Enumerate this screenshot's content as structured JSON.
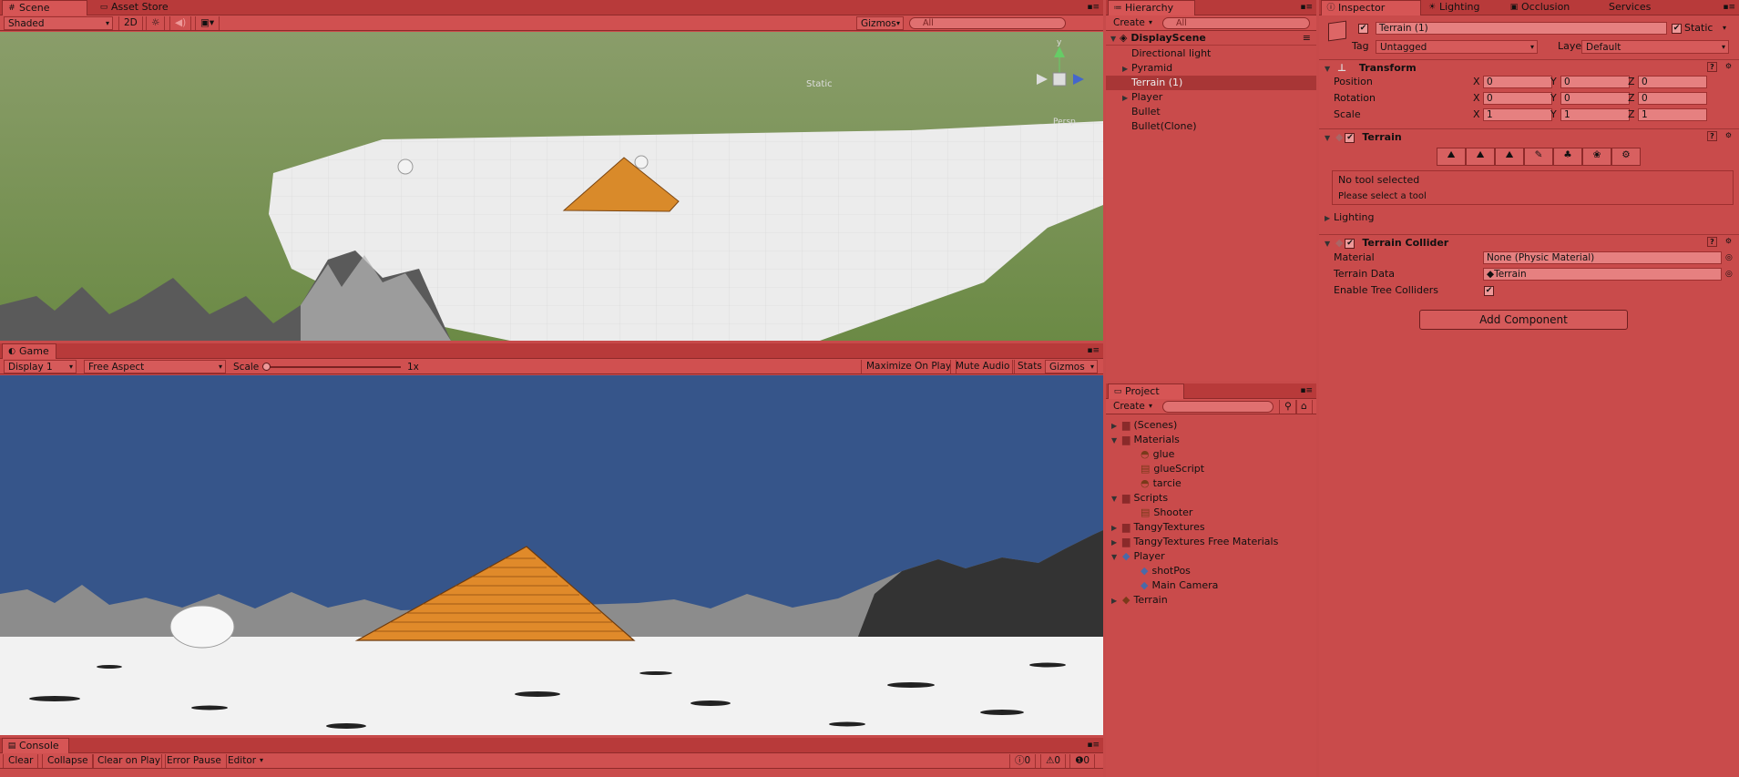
{
  "scene": {
    "tabs": [
      "Scene",
      "Asset Store"
    ],
    "shading": "Shaded",
    "mode_2d": "2D",
    "gizmos": "Gizmos",
    "search_placeholder": "All",
    "axis_labels": {
      "y": "y",
      "persp": "Persp"
    },
    "static_label": "Static"
  },
  "game": {
    "tab": "Game",
    "display": "Display 1",
    "aspect": "Free Aspect",
    "scale_label": "Scale",
    "scale_value": "1x",
    "buttons": [
      "Maximize On Play",
      "Mute Audio",
      "Stats",
      "Gizmos"
    ]
  },
  "console": {
    "tab": "Console",
    "buttons": [
      "Clear",
      "Collapse",
      "Clear on Play",
      "Error Pause",
      "Editor"
    ],
    "counts": [
      "0",
      "0",
      "0"
    ]
  },
  "hierarchy": {
    "tab": "Hierarchy",
    "create": "Create",
    "search_placeholder": "All",
    "scene_name": "DisplayScene",
    "items": [
      {
        "label": "Directional light",
        "expandable": false,
        "selected": false
      },
      {
        "label": "Pyramid",
        "expandable": true,
        "selected": false
      },
      {
        "label": "Terrain (1)",
        "expandable": false,
        "selected": true
      },
      {
        "label": "Player",
        "expandable": true,
        "selected": false
      },
      {
        "label": "Bullet",
        "expandable": false,
        "selected": false
      },
      {
        "label": "Bullet(Clone)",
        "expandable": false,
        "selected": false
      }
    ]
  },
  "project": {
    "tab": "Project",
    "create": "Create",
    "items": [
      {
        "label": "(Scenes)",
        "indent": 0,
        "icon": "folder",
        "arrow": "▶"
      },
      {
        "label": "Materials",
        "indent": 0,
        "icon": "folder",
        "arrow": "▼"
      },
      {
        "label": "glue",
        "indent": 1,
        "icon": "material",
        "arrow": ""
      },
      {
        "label": "glueScript",
        "indent": 1,
        "icon": "script",
        "arrow": ""
      },
      {
        "label": "tarcie",
        "indent": 1,
        "icon": "material",
        "arrow": ""
      },
      {
        "label": "Scripts",
        "indent": 0,
        "icon": "folder",
        "arrow": "▼"
      },
      {
        "label": "Shooter",
        "indent": 1,
        "icon": "script",
        "arrow": ""
      },
      {
        "label": "TangyTextures",
        "indent": 0,
        "icon": "folder",
        "arrow": "▶"
      },
      {
        "label": "TangyTextures Free Materials",
        "indent": 0,
        "icon": "folder",
        "arrow": "▶"
      },
      {
        "label": "Player",
        "indent": 0,
        "icon": "prefab",
        "arrow": "▼"
      },
      {
        "label": "shotPos",
        "indent": 1,
        "icon": "prefab",
        "arrow": ""
      },
      {
        "label": "Main Camera",
        "indent": 1,
        "icon": "prefab",
        "arrow": ""
      },
      {
        "label": "Terrain",
        "indent": 0,
        "icon": "prefab-red",
        "arrow": "▶"
      }
    ]
  },
  "inspector": {
    "tabs": [
      "Inspector",
      "Lighting",
      "Occlusion",
      "Services"
    ],
    "object_name": "Terrain (1)",
    "static_label": "Static",
    "tag_label": "Tag",
    "tag_value": "Untagged",
    "layer_label": "Layer",
    "layer_value": "Default",
    "transform": {
      "title": "Transform",
      "rows": [
        {
          "label": "Position",
          "x": "0",
          "y": "0",
          "z": "0"
        },
        {
          "label": "Rotation",
          "x": "0",
          "y": "0",
          "z": "0"
        },
        {
          "label": "Scale",
          "x": "1",
          "y": "1",
          "z": "1"
        }
      ],
      "axes": [
        "X",
        "Y",
        "Z"
      ]
    },
    "terrain": {
      "title": "Terrain",
      "no_tool": "No tool selected",
      "please_select": "Please select a tool",
      "lighting": "Lighting"
    },
    "collider": {
      "title": "Terrain Collider",
      "material_label": "Material",
      "material_value": "None (Physic Material)",
      "data_label": "Terrain Data",
      "data_value": "Terrain",
      "trees_label": "Enable Tree Colliders"
    },
    "add_component": "Add Component"
  },
  "colors": {
    "panel": "#c94b4b",
    "tabbar": "#b83a3a",
    "sky": "#36558a",
    "grass": "#6b8a45"
  }
}
